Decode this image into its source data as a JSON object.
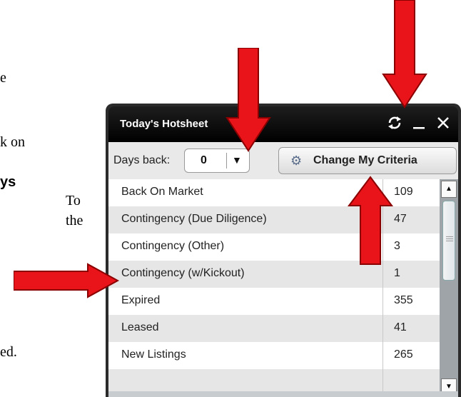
{
  "background_text": {
    "line1": "e",
    "line2": "k on",
    "line3": "ys",
    "line4": "To",
    "line5": "the",
    "line6": "ed."
  },
  "widget": {
    "title": "Today's Hotsheet",
    "icons": [
      "refresh-icon",
      "minimize-icon",
      "close-icon"
    ],
    "days_back_label": "Days back:",
    "days_back_value": "0",
    "criteria_button_label": "Change My Criteria",
    "rows": [
      {
        "label": "Back On Market",
        "count": "109"
      },
      {
        "label": "Contingency (Due Diligence)",
        "count": "47"
      },
      {
        "label": "Contingency (Other)",
        "count": "3"
      },
      {
        "label": "Contingency (w/Kickout)",
        "count": "1"
      },
      {
        "label": "Expired",
        "count": "355"
      },
      {
        "label": "Leased",
        "count": "41"
      },
      {
        "label": "New Listings",
        "count": "265"
      }
    ]
  },
  "colors": {
    "annotation_arrow": "#e8141a",
    "titlebar": "#000000"
  }
}
